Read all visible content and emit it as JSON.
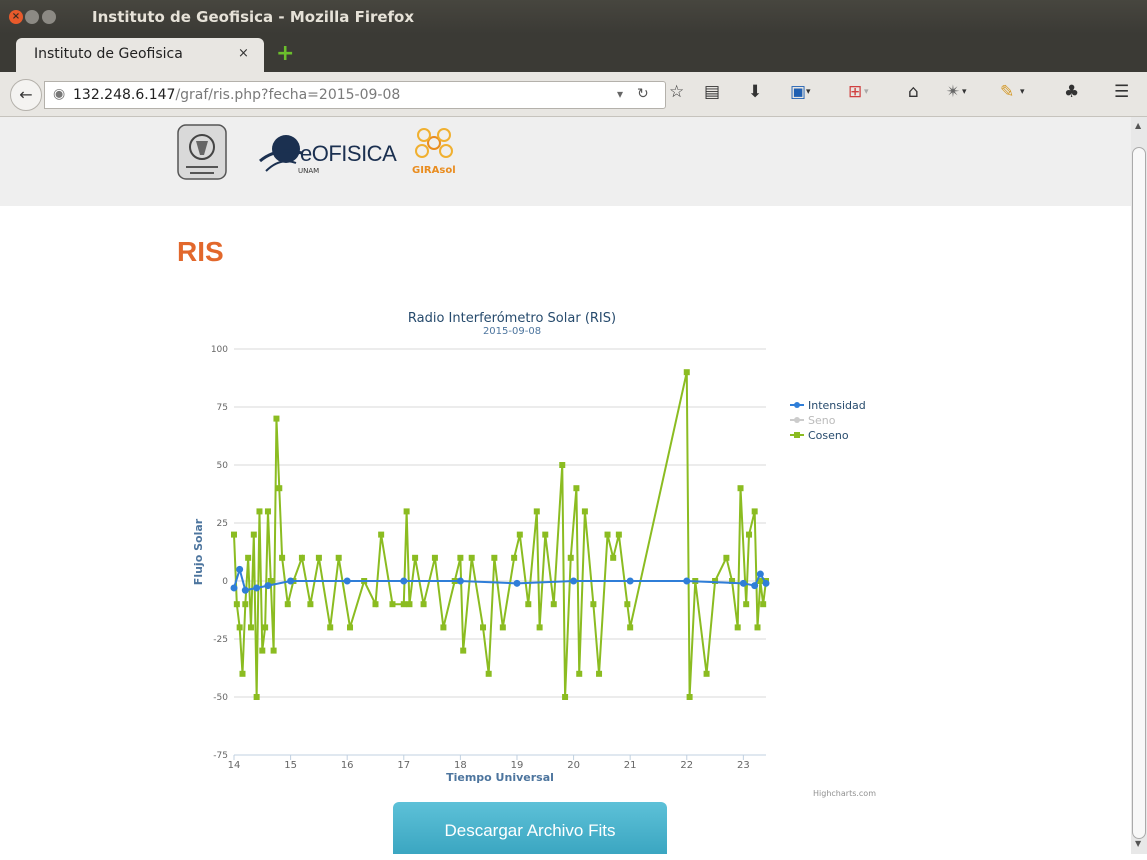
{
  "window": {
    "title": "Instituto de Geofisica - Mozilla Firefox"
  },
  "tab": {
    "label": "Instituto de Geofisica",
    "close": "×",
    "new": "+"
  },
  "address": {
    "host": "132.248.6.147",
    "path": "/graf/ris.php?fecha=2015-09-08"
  },
  "logos": {
    "geofisica": "eOFISICA",
    "geofisica_sub": "UNAM",
    "girasol": "GIRAsol"
  },
  "page": {
    "heading": "RIS",
    "download_button": "Descargar Archivo Fits"
  },
  "chart_data": {
    "type": "line",
    "title": "Radio Interferómetro Solar (RIS)",
    "subtitle": "2015-09-08",
    "xlabel": "Tiempo Universal",
    "ylabel": "Flujo Solar",
    "credits": "Highcharts.com",
    "xlim": [
      14,
      23.4
    ],
    "ylim": [
      -75,
      100
    ],
    "x_ticks": [
      "14",
      "15",
      "16",
      "17",
      "18",
      "19",
      "20",
      "21",
      "22",
      "23"
    ],
    "y_ticks": [
      "100",
      "75",
      "50",
      "25",
      "0",
      "-25",
      "-50",
      "-75"
    ],
    "legend_position": "right",
    "series": [
      {
        "name": "Intensidad",
        "color": "#2f7ed8",
        "visible": true,
        "points": [
          [
            14.0,
            -3
          ],
          [
            14.1,
            5
          ],
          [
            14.2,
            -4
          ],
          [
            14.4,
            -3
          ],
          [
            14.6,
            -2
          ],
          [
            15.0,
            0
          ],
          [
            16.0,
            0
          ],
          [
            17.0,
            0
          ],
          [
            18.0,
            0
          ],
          [
            19.0,
            -1
          ],
          [
            20.0,
            0
          ],
          [
            21.0,
            0
          ],
          [
            22.0,
            0
          ],
          [
            23.0,
            -1
          ],
          [
            23.2,
            -2
          ],
          [
            23.3,
            3
          ],
          [
            23.4,
            -1
          ]
        ]
      },
      {
        "name": "Seno",
        "color": "#cccccc",
        "visible": false,
        "points": []
      },
      {
        "name": "Coseno",
        "color": "#8bbc21",
        "visible": true,
        "points": [
          [
            14.0,
            20
          ],
          [
            14.05,
            -10
          ],
          [
            14.1,
            -20
          ],
          [
            14.15,
            -40
          ],
          [
            14.2,
            -10
          ],
          [
            14.25,
            10
          ],
          [
            14.3,
            -20
          ],
          [
            14.35,
            20
          ],
          [
            14.4,
            -50
          ],
          [
            14.45,
            30
          ],
          [
            14.5,
            -30
          ],
          [
            14.55,
            -20
          ],
          [
            14.6,
            30
          ],
          [
            14.65,
            0
          ],
          [
            14.7,
            -30
          ],
          [
            14.75,
            70
          ],
          [
            14.8,
            40
          ],
          [
            14.85,
            10
          ],
          [
            14.95,
            -10
          ],
          [
            15.05,
            0
          ],
          [
            15.2,
            10
          ],
          [
            15.35,
            -10
          ],
          [
            15.5,
            10
          ],
          [
            15.7,
            -20
          ],
          [
            15.85,
            10
          ],
          [
            16.05,
            -20
          ],
          [
            16.3,
            0
          ],
          [
            16.5,
            -10
          ],
          [
            16.6,
            20
          ],
          [
            16.8,
            -10
          ],
          [
            17.0,
            -10
          ],
          [
            17.05,
            30
          ],
          [
            17.1,
            -10
          ],
          [
            17.2,
            10
          ],
          [
            17.35,
            -10
          ],
          [
            17.55,
            10
          ],
          [
            17.7,
            -20
          ],
          [
            17.9,
            0
          ],
          [
            18.0,
            10
          ],
          [
            18.05,
            -30
          ],
          [
            18.2,
            10
          ],
          [
            18.4,
            -20
          ],
          [
            18.5,
            -40
          ],
          [
            18.6,
            10
          ],
          [
            18.75,
            -20
          ],
          [
            18.95,
            10
          ],
          [
            19.05,
            20
          ],
          [
            19.2,
            -10
          ],
          [
            19.35,
            30
          ],
          [
            19.4,
            -20
          ],
          [
            19.5,
            20
          ],
          [
            19.65,
            -10
          ],
          [
            19.8,
            50
          ],
          [
            19.85,
            -50
          ],
          [
            19.95,
            10
          ],
          [
            20.05,
            40
          ],
          [
            20.1,
            -40
          ],
          [
            20.2,
            30
          ],
          [
            20.35,
            -10
          ],
          [
            20.45,
            -40
          ],
          [
            20.6,
            20
          ],
          [
            20.7,
            10
          ],
          [
            20.8,
            20
          ],
          [
            20.95,
            -10
          ],
          [
            21.0,
            -20
          ],
          [
            22.0,
            90
          ],
          [
            22.05,
            -50
          ],
          [
            22.15,
            0
          ],
          [
            22.35,
            -40
          ],
          [
            22.5,
            0
          ],
          [
            22.7,
            10
          ],
          [
            22.8,
            0
          ],
          [
            22.9,
            -20
          ],
          [
            22.95,
            40
          ],
          [
            23.05,
            -10
          ],
          [
            23.1,
            20
          ],
          [
            23.2,
            30
          ],
          [
            23.25,
            -20
          ],
          [
            23.3,
            0
          ],
          [
            23.35,
            -10
          ],
          [
            23.4,
            0
          ]
        ]
      }
    ]
  }
}
